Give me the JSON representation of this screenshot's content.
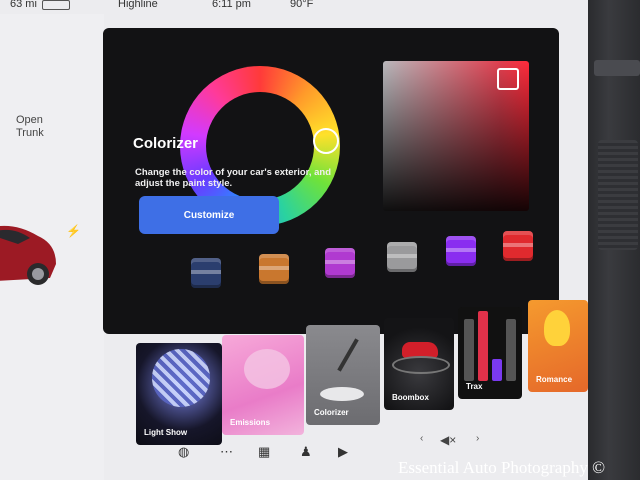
{
  "status_bar": {
    "range": "63 mi",
    "driver": "Highline",
    "time": "6:11 pm",
    "temperature": "90°F"
  },
  "car_panel": {
    "trunk_label_1": "Open",
    "trunk_label_2": "Trunk",
    "charge_icon": "lightning-icon"
  },
  "colorizer": {
    "title": "Colorizer",
    "description": "Change the color of your car's exterior, and adjust the paint style.",
    "button_label": "Customize",
    "accent": "#3e6fe6",
    "swatches": [
      "#2b3e6e",
      "#c9772e",
      "#b03ad0",
      "#9a9a9c",
      "#8a2df0",
      "#e02a2e"
    ]
  },
  "apps": [
    {
      "label": "Light Show"
    },
    {
      "label": "Emissions"
    },
    {
      "label": "Colorizer"
    },
    {
      "label": "Boombox"
    },
    {
      "label": "Trax"
    },
    {
      "label": "Romance"
    }
  ],
  "dock": {
    "mute_icon": "mute-icon",
    "prev_icon": "chevron-left-icon",
    "next_icon": "chevron-right-icon",
    "mute_glyph": "◀×"
  },
  "watermark": "Essential Auto Photography ©"
}
